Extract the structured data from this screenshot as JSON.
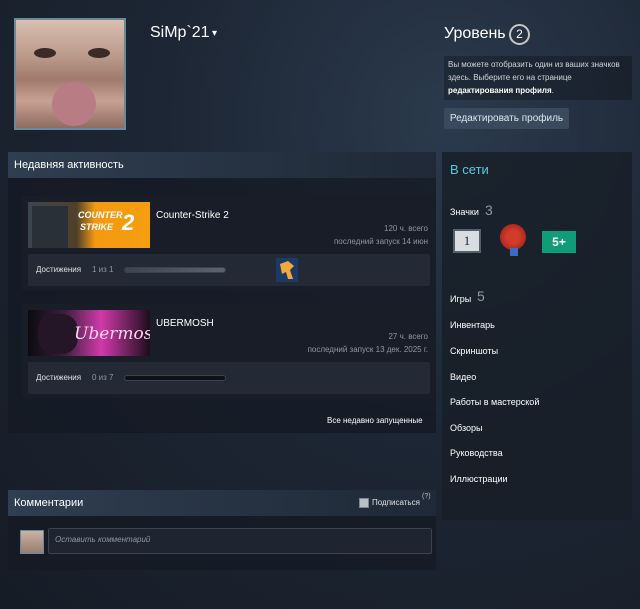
{
  "profile": {
    "name": "SiMp`21",
    "caret": "▾"
  },
  "level": {
    "title": "Уровень",
    "value": "2",
    "desc_text": "Вы можете отобразить один из ваших значков здесь. Выберите его на странице",
    "desc_bold": "редактирования профиля",
    "desc_end": ".",
    "edit_button": "Редактировать профиль"
  },
  "activity": {
    "header": "Недавняя активность",
    "games": [
      {
        "name": "Counter-Strike 2",
        "hours": "120 ч. всего",
        "last_played": "последний запуск 14 июн",
        "ach_label": "Достижения",
        "ach_count": "1 из 1",
        "ach_progress": 1.0,
        "cap_icon": "counter-strike-2-capsule"
      },
      {
        "name": "UBERMOSH",
        "hours": "27 ч. всего",
        "last_played": "последний запуск 13 дек. 2025 г.",
        "ach_label": "Достижения",
        "ach_count": "0 из 7",
        "ach_progress": 0.0,
        "cap_icon": "ubermosh-capsule"
      }
    ],
    "all_link": "Все недавно запущенные"
  },
  "comments": {
    "title": "Комментарии",
    "subscribe": "Подписаться",
    "help": "(?)",
    "placeholder": "Оставить комментарий"
  },
  "sidebar": {
    "online": "В сети",
    "badges_label": "Значки",
    "badges_count": "3",
    "badge_one_text": "1",
    "badge_three_text": "5+",
    "games_label": "Игры",
    "games_count": "5",
    "links": [
      "Инвентарь",
      "Скриншоты",
      "Видео",
      "Работы в мастерской",
      "Обзоры",
      "Руководства",
      "Иллюстрации"
    ]
  },
  "cs_cap_text": [
    "COUNTER",
    "STRIKE",
    "2"
  ],
  "ub_cap_text": "Ubermosh"
}
